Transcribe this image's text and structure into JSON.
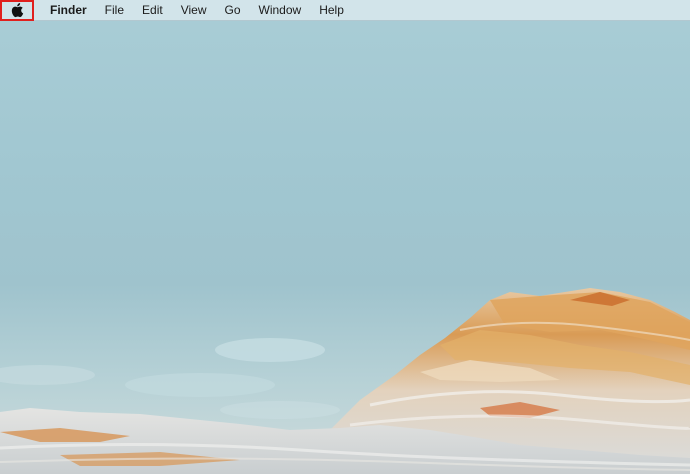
{
  "menubar": {
    "apple_icon": "apple-logo-icon",
    "apple_highlighted": true,
    "app_name": "Finder",
    "items": [
      {
        "label": "File"
      },
      {
        "label": "Edit"
      },
      {
        "label": "View"
      },
      {
        "label": "Go"
      },
      {
        "label": "Window"
      },
      {
        "label": "Help"
      }
    ]
  },
  "colors": {
    "highlight": "#e0201e",
    "sky": "#a1c7d1",
    "rock_orange": "#d98a3c"
  }
}
